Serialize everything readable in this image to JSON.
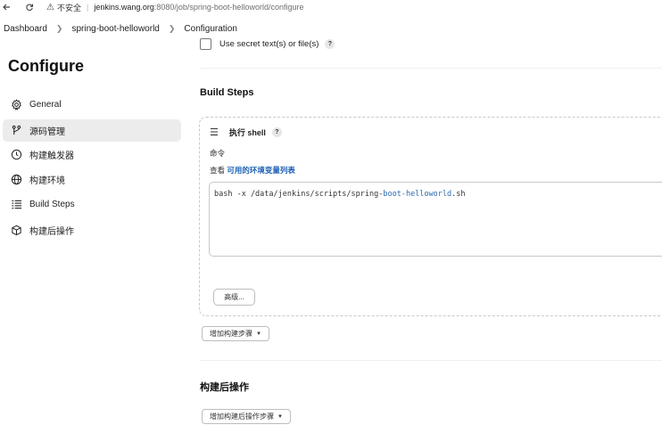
{
  "browser": {
    "security_label": "不安全",
    "url_host": "jenkins.wang.org",
    "url_path": ":8080/job/spring-boot-helloworld/configure"
  },
  "breadcrumb": [
    "Dashboard",
    "spring-boot-helloworld",
    "Configuration"
  ],
  "sidebar": {
    "title": "Configure",
    "items": [
      {
        "label": "General",
        "icon": "gear-icon"
      },
      {
        "label": "源码管理",
        "icon": "branch-icon",
        "active": true
      },
      {
        "label": "构建触发器",
        "icon": "clock-icon"
      },
      {
        "label": "构建环境",
        "icon": "globe-icon"
      },
      {
        "label": "Build Steps",
        "icon": "list-icon"
      },
      {
        "label": "构建后操作",
        "icon": "package-icon"
      }
    ]
  },
  "main": {
    "secret_checkbox_label": "Use secret text(s) or file(s)",
    "help": "?",
    "build_steps_title": "Build Steps",
    "step": {
      "title": "执行 shell",
      "command_label": "命令",
      "env_prefix": "查看 ",
      "env_link": "可用的环境变量列表",
      "code_before": "bash -x /data/jenkins/scripts/spring-",
      "code_highlight": "boot-helloworld",
      "code_after": ".sh",
      "advanced_button": "高级..."
    },
    "add_build_step_button": "增加构建步骤",
    "post_build_title": "构建后操作",
    "add_post_build_button": "增加构建后操作步骤"
  }
}
